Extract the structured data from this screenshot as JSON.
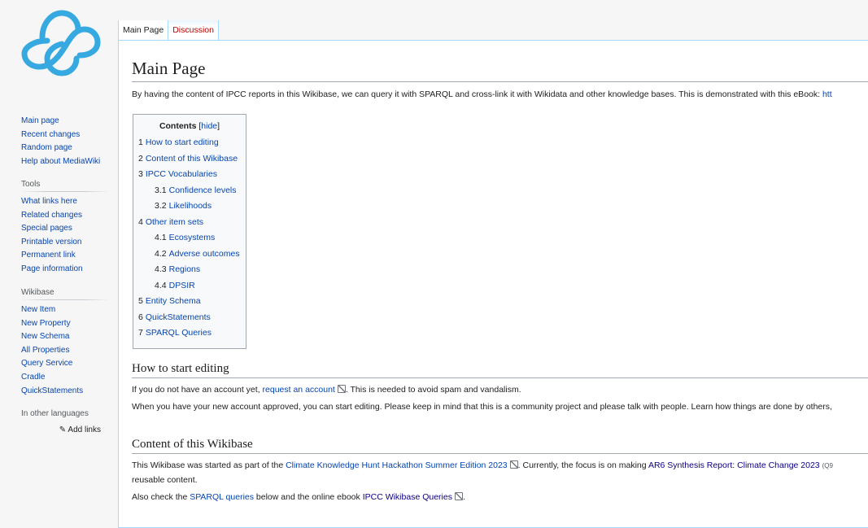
{
  "sidebar": {
    "navigation": [
      "Main page",
      "Recent changes",
      "Random page",
      "Help about MediaWiki"
    ],
    "tools": {
      "heading": "Tools",
      "items": [
        "What links here",
        "Related changes",
        "Special pages",
        "Printable version",
        "Permanent link",
        "Page information"
      ]
    },
    "wikibase": {
      "heading": "Wikibase",
      "items": [
        "New Item",
        "New Property",
        "New Schema",
        "All Properties",
        "Query Service",
        "Cradle",
        "QuickStatements"
      ]
    },
    "languages": {
      "heading": "In other languages",
      "add_links": "Add links"
    }
  },
  "tabs": [
    "Main Page",
    "Discussion"
  ],
  "page": {
    "title": "Main Page",
    "intro_text": "By having the content of IPCC reports in this Wikibase, we can query it with SPARQL and cross-link it with Wikidata and other knowledge bases. This is demonstrated with this eBook: ",
    "intro_link": "htt"
  },
  "toc": {
    "title": "Contents",
    "hide": "hide",
    "items": [
      {
        "num": "1",
        "label": "How to start editing"
      },
      {
        "num": "2",
        "label": "Content of this Wikibase"
      },
      {
        "num": "3",
        "label": "IPCC Vocabularies"
      },
      {
        "num": "3.1",
        "label": "Confidence levels"
      },
      {
        "num": "3.2",
        "label": "Likelihoods"
      },
      {
        "num": "4",
        "label": "Other item sets"
      },
      {
        "num": "4.1",
        "label": "Ecosystems"
      },
      {
        "num": "4.2",
        "label": "Adverse outcomes"
      },
      {
        "num": "4.3",
        "label": "Regions"
      },
      {
        "num": "4.4",
        "label": "DPSIR"
      },
      {
        "num": "5",
        "label": "Entity Schema"
      },
      {
        "num": "6",
        "label": "QuickStatements"
      },
      {
        "num": "7",
        "label": "SPARQL Queries"
      }
    ]
  },
  "sections": {
    "editing": {
      "heading": "How to start editing",
      "p1_before": "If you do not have an account yet, ",
      "p1_link": "request an account",
      "p1_after": ". This is needed to avoid spam and vandalism.",
      "p2": "When you have your new account approved, you can start editing. Please keep in mind that this is a community project and please talk with people. Learn how things are done by others,"
    },
    "content": {
      "heading": "Content of this Wikibase",
      "p1_before": "This Wikibase was started as part of the ",
      "p1_link": "Climate Knowledge Hunt Hackathon Summer Edition 2023",
      "p1_mid": ". Currently, the focus is on making ",
      "p1_link2": "AR6 Synthesis Report: Climate Change 2023",
      "p1_q": "(Q9",
      "p1_line2": "reusable content.",
      "p2_before": "Also check the ",
      "p2_link": "SPARQL queries",
      "p2_mid": " below and the online ebook ",
      "p2_link2": "IPCC Wikibase Queries",
      "p2_after": "."
    }
  },
  "colors": {
    "link": "#0645ad",
    "visited_link": "#0b0080",
    "logo": "#36a9e1",
    "border": "#a7d7f9"
  }
}
